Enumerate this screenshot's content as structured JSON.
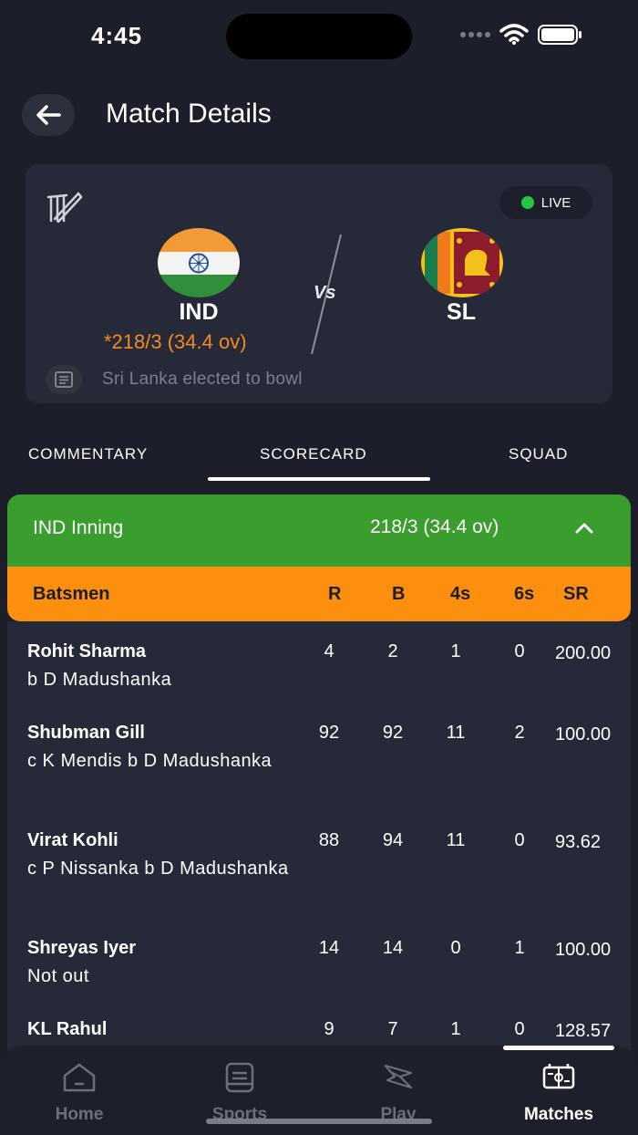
{
  "status_bar": {
    "time": "4:45"
  },
  "header": {
    "title": "Match Details"
  },
  "match": {
    "live_label": "LIVE",
    "team1": {
      "code": "IND",
      "score": "*218/3 (34.4 ov)"
    },
    "team2": {
      "code": "SL"
    },
    "toss": "Sri Lanka elected to bowl"
  },
  "tabs": [
    {
      "label": "COMMENTARY"
    },
    {
      "label": "SCORECARD"
    },
    {
      "label": "SQUAD"
    }
  ],
  "innings": {
    "title": "IND Inning",
    "score": "218/3 (34.4 ov)"
  },
  "batsmen_columns": {
    "name": "Batsmen",
    "r": "R",
    "b": "B",
    "fours": "4s",
    "sixes": "6s",
    "sr": "SR"
  },
  "batsmen": [
    {
      "name": "Rohit Sharma",
      "dismissal": "b D Madushanka",
      "r": "4",
      "b": "2",
      "fours": "1",
      "sixes": "0",
      "sr": "200.00"
    },
    {
      "name": "Shubman Gill",
      "dismissal": "c K Mendis b D Madushanka",
      "r": "92",
      "b": "92",
      "fours": "11",
      "sixes": "2",
      "sr": "100.00"
    },
    {
      "name": "Virat Kohli",
      "dismissal": "c P Nissanka b D Madushanka",
      "r": "88",
      "b": "94",
      "fours": "11",
      "sixes": "0",
      "sr": "93.62"
    },
    {
      "name": "Shreyas Iyer",
      "dismissal": "Not out",
      "r": "14",
      "b": "14",
      "fours": "0",
      "sixes": "1",
      "sr": "100.00"
    },
    {
      "name": "KL Rahul",
      "dismissal": "",
      "r": "9",
      "b": "7",
      "fours": "1",
      "sixes": "0",
      "sr": "128.57"
    }
  ],
  "bottom_nav": [
    {
      "label": "Home",
      "icon": "home-icon"
    },
    {
      "label": "Sports",
      "icon": "sports-icon"
    },
    {
      "label": "Play",
      "icon": "play-icon"
    },
    {
      "label": "Matches",
      "icon": "matches-icon"
    }
  ],
  "colors": {
    "background": "#1c1e29",
    "card": "#262a38",
    "innings_green": "#3a9e2f",
    "header_orange": "#fd8f0f",
    "score_orange": "#f4891f",
    "live_green": "#24c63d"
  }
}
